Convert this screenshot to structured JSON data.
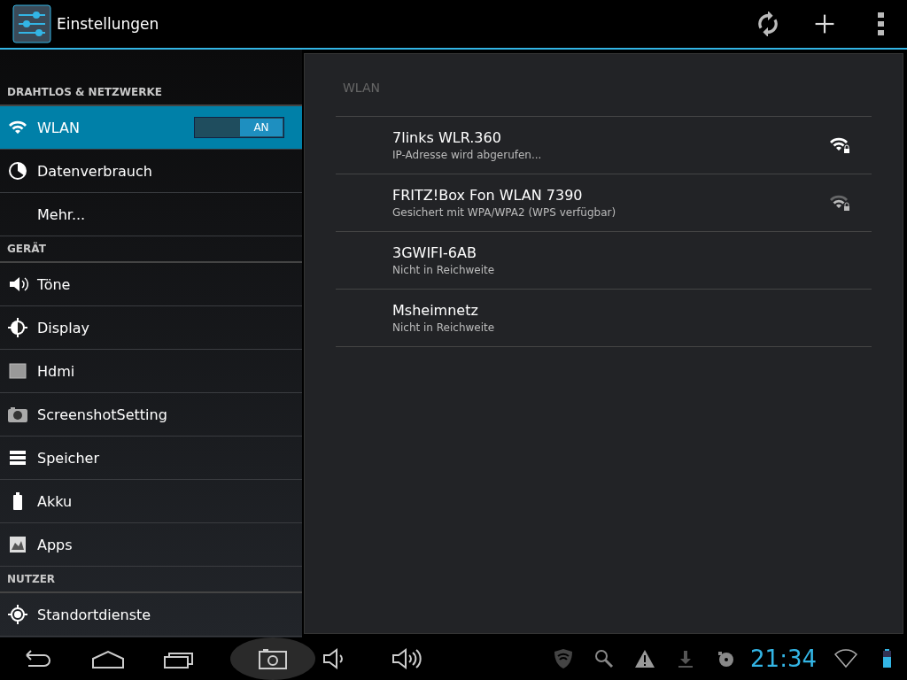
{
  "action_bar": {
    "title": "Einstellungen"
  },
  "sidebar": {
    "items": [
      {
        "kind": "header",
        "label": "DRAHTLOS & NETZWERKE"
      },
      {
        "kind": "item",
        "label": "WLAN",
        "selected": true,
        "toggle": {
          "on": true,
          "label": "AN"
        }
      },
      {
        "kind": "item",
        "label": "Datenverbrauch",
        "selected": false
      },
      {
        "kind": "item",
        "label": "Mehr...",
        "selected": false
      },
      {
        "kind": "header",
        "label": "GERÄT"
      },
      {
        "kind": "item",
        "label": "Töne",
        "selected": false
      },
      {
        "kind": "item",
        "label": "Display",
        "selected": false
      },
      {
        "kind": "item",
        "label": "Hdmi",
        "selected": false
      },
      {
        "kind": "item",
        "label": "ScreenshotSetting",
        "selected": false
      },
      {
        "kind": "item",
        "label": "Speicher",
        "selected": false
      },
      {
        "kind": "item",
        "label": "Akku",
        "selected": false
      },
      {
        "kind": "item",
        "label": "Apps",
        "selected": false
      },
      {
        "kind": "header",
        "label": "NUTZER"
      },
      {
        "kind": "item",
        "label": "Standortdienste",
        "selected": false
      }
    ]
  },
  "panel": {
    "title": "WLAN",
    "networks": [
      {
        "name": "7links WLR.360",
        "status": "IP-Adresse wird abgerufen...",
        "kind": "strong"
      },
      {
        "name": "FRITZ!Box Fon WLAN 7390",
        "status": "Gesichert mit WPA/WPA2 (WPS verfügbar)",
        "kind": "weak"
      },
      {
        "name": "3GWIFI-6AB",
        "status": "Nicht in Reichweite",
        "kind": "none"
      },
      {
        "name": "Msheimnetz",
        "status": "Nicht in Reichweite",
        "kind": "none"
      }
    ]
  },
  "status_bar": {
    "clock": "21:34"
  }
}
